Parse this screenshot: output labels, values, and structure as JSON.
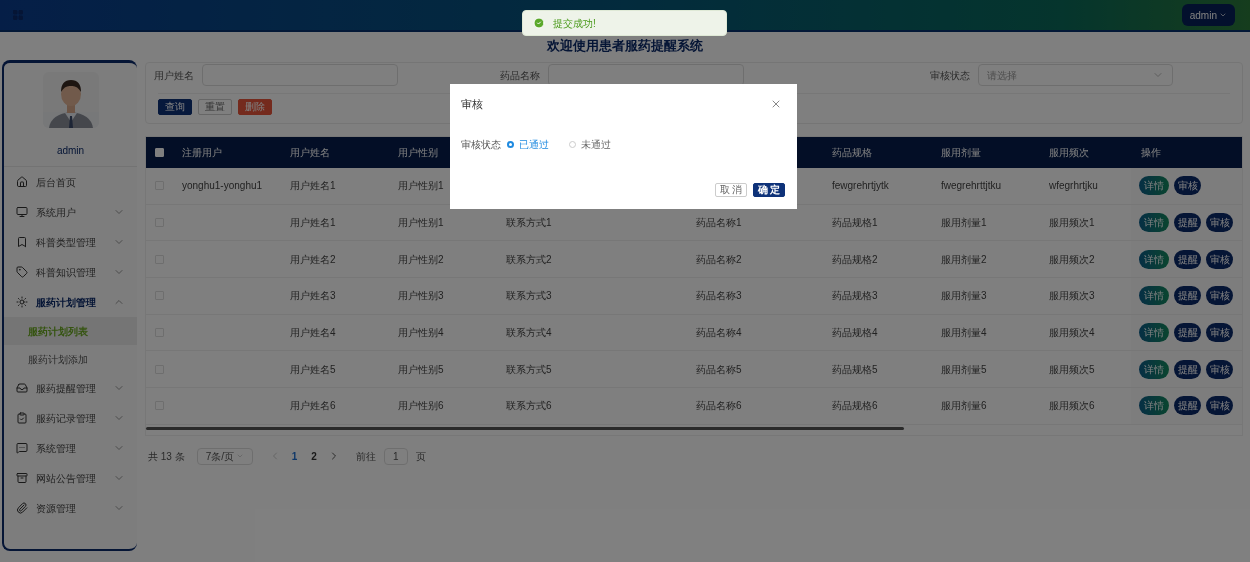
{
  "header": {
    "user_menu": "admin"
  },
  "toast": {
    "text": "提交成功!"
  },
  "page_title": "欢迎使用患者服药提醒系统",
  "sidebar": {
    "username": "admin",
    "items": [
      {
        "label": "后台首页"
      },
      {
        "label": "系统用户",
        "expanded": false
      },
      {
        "label": "科普类型管理",
        "expanded": false
      },
      {
        "label": "科普知识管理",
        "expanded": false
      },
      {
        "label": "服药计划管理",
        "expanded": true,
        "children": [
          {
            "label": "服药计划列表",
            "selected": true
          },
          {
            "label": "服药计划添加",
            "selected": false
          }
        ]
      },
      {
        "label": "服药提醒管理",
        "expanded": false
      },
      {
        "label": "服药记录管理",
        "expanded": false
      },
      {
        "label": "系统管理",
        "expanded": false
      },
      {
        "label": "网站公告管理",
        "expanded": false
      },
      {
        "label": "资源管理",
        "expanded": false
      }
    ]
  },
  "search": {
    "fields": [
      {
        "label": "用户姓名",
        "kind": "input"
      },
      {
        "label": "药品名称",
        "kind": "input"
      },
      {
        "label": "审核状态",
        "kind": "select",
        "placeholder": "请选择"
      }
    ],
    "buttons": [
      {
        "label": "查询",
        "kind": "primary"
      },
      {
        "label": "重置",
        "kind": "plain"
      },
      {
        "label": "删除",
        "kind": "danger"
      }
    ]
  },
  "table": {
    "all_checked": false,
    "columns": [
      "注册用户",
      "用户姓名",
      "用户性别",
      null,
      null,
      "药品规格",
      "服用剂量",
      "服用频次",
      "操作"
    ],
    "rows": [
      {
        "checked": false,
        "cells": [
          "yonghu1-yonghu1",
          "用户姓名1",
          "用户性别1",
          null,
          null,
          "fewgrehrtjytk",
          "fwegrehrttjtku",
          "wfegrhrtjku"
        ],
        "actions": [
          "详情",
          "审核"
        ]
      },
      {
        "checked": false,
        "cells": [
          null,
          "用户姓名1",
          "用户性别1",
          "联系方式1",
          "药品名称1",
          "药品规格1",
          "服用剂量1",
          "服用频次1"
        ],
        "actions": [
          "详情",
          "提醒",
          "审核"
        ]
      },
      {
        "checked": false,
        "cells": [
          null,
          "用户姓名2",
          "用户性别2",
          "联系方式2",
          "药品名称2",
          "药品规格2",
          "服用剂量2",
          "服用频次2"
        ],
        "actions": [
          "详情",
          "提醒",
          "审核"
        ]
      },
      {
        "checked": false,
        "cells": [
          null,
          "用户姓名3",
          "用户性别3",
          "联系方式3",
          "药品名称3",
          "药品规格3",
          "服用剂量3",
          "服用频次3"
        ],
        "actions": [
          "详情",
          "提醒",
          "审核"
        ]
      },
      {
        "checked": false,
        "cells": [
          null,
          "用户姓名4",
          "用户性别4",
          "联系方式4",
          "药品名称4",
          "药品规格4",
          "服用剂量4",
          "服用频次4"
        ],
        "actions": [
          "详情",
          "提醒",
          "审核"
        ]
      },
      {
        "checked": false,
        "cells": [
          null,
          "用户姓名5",
          "用户性别5",
          "联系方式5",
          "药品名称5",
          "药品规格5",
          "服用剂量5",
          "服用频次5"
        ],
        "actions": [
          "详情",
          "提醒",
          "审核"
        ]
      },
      {
        "checked": false,
        "cells": [
          null,
          "用户姓名6",
          "用户性别6",
          "联系方式6",
          "药品名称6",
          "药品规格6",
          "服用剂量6",
          "服用频次6"
        ],
        "actions": [
          "详情",
          "提醒",
          "审核"
        ]
      }
    ]
  },
  "pagination": {
    "total": "共 13 条",
    "page_size": "7条/页",
    "pages": [
      {
        "label": "1",
        "selected": true
      },
      {
        "label": "2",
        "selected": false
      }
    ],
    "goto_label": "前往",
    "goto_value": "1",
    "goto_suffix": "页"
  },
  "dialog": {
    "title": "审核",
    "field_label": "审核状态",
    "options": [
      {
        "label": "已通过",
        "selected": true
      },
      {
        "label": "未通过",
        "selected": false
      }
    ],
    "buttons": [
      {
        "label": "取 消",
        "kind": "plain"
      },
      {
        "label": "确 定",
        "kind": "primary"
      }
    ]
  }
}
